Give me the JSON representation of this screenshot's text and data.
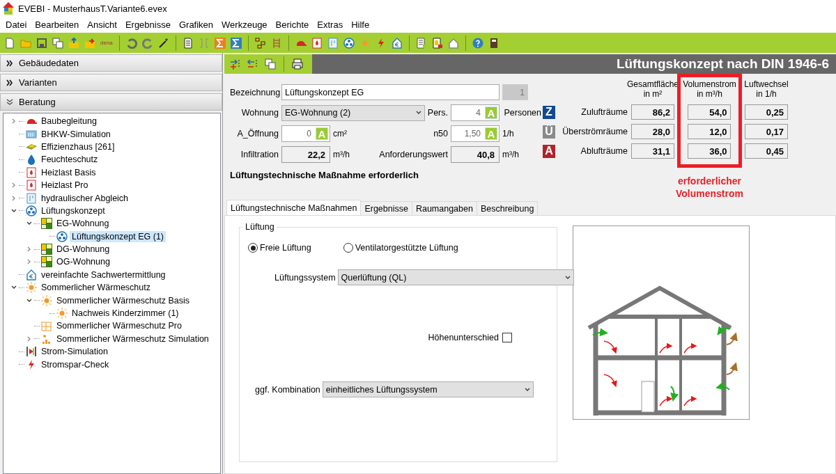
{
  "window": {
    "title": "EVEBI - MusterhausT.Variante6.evex"
  },
  "menu": [
    "Datei",
    "Bearbeiten",
    "Ansicht",
    "Ergebnisse",
    "Grafiken",
    "Werkzeuge",
    "Berichte",
    "Extras",
    "Hilfe"
  ],
  "toolbar": {
    "dena_label": "dena"
  },
  "sidebar": {
    "sections": [
      {
        "label": "Gebäudedaten",
        "expanded": false
      },
      {
        "label": "Varianten",
        "expanded": false
      },
      {
        "label": "Beratung",
        "expanded": true
      }
    ],
    "tree": [
      {
        "label": "Baubegleitung",
        "kind": "cap",
        "expanded": false,
        "selected": false
      },
      {
        "label": "BHKW-Simulation",
        "kind": "chp",
        "selected": false
      },
      {
        "label": "Effizienzhaus [261]",
        "kind": "effizienz",
        "selected": false
      },
      {
        "label": "Feuchteschutz",
        "kind": "drop",
        "selected": false
      },
      {
        "label": "Heizlast Basis",
        "kind": "heat",
        "selected": false
      },
      {
        "label": "Heizlast Pro",
        "kind": "heat",
        "expanded": false,
        "selected": false
      },
      {
        "label": "hydraulischer Abgleich",
        "kind": "hydraulic",
        "expanded": false,
        "selected": false
      },
      {
        "label": "Lüftungskonzept",
        "kind": "fan",
        "expanded": true,
        "selected": false,
        "children": [
          {
            "label": "EG-Wohnung",
            "kind": "flat",
            "expanded": true,
            "selected": false,
            "children": [
              {
                "label": "Lüftungskonzept EG (1)",
                "kind": "fan",
                "selected": true
              }
            ]
          },
          {
            "label": "DG-Wohnung",
            "kind": "flat",
            "expanded": false,
            "selected": false
          },
          {
            "label": "OG-Wohnung",
            "kind": "flat",
            "expanded": false,
            "selected": false
          }
        ]
      },
      {
        "label": "vereinfachte Sachwertermittlung",
        "kind": "euro-house",
        "selected": false
      },
      {
        "label": "Sommerlicher Wärmeschutz",
        "kind": "sun",
        "expanded": true,
        "selected": false,
        "children": [
          {
            "label": "Sommerlicher Wärmeschutz Basis",
            "kind": "sun",
            "expanded": true,
            "selected": false,
            "children": [
              {
                "label": "Nachweis Kinderzimmer (1)",
                "kind": "sun",
                "selected": false
              }
            ]
          },
          {
            "label": "Sommerlicher Wärmeschutz Pro",
            "kind": "grid",
            "selected": false
          },
          {
            "label": "Sommerlicher Wärmeschutz Simulation",
            "kind": "chart-sun",
            "expanded": false,
            "selected": false
          }
        ]
      },
      {
        "label": "Strom-Simulation",
        "kind": "power",
        "selected": false
      },
      {
        "label": "Stromspar-Check",
        "kind": "bolt",
        "selected": false
      }
    ]
  },
  "panel": {
    "title": "Lüftungskonzept nach DIN 1946-6",
    "form": {
      "name": {
        "label": "Bezeichnung",
        "value": "Lüftungskonzept EG",
        "number": "1"
      },
      "dwelling": {
        "label": "Wohnung",
        "value": "EG-Wohnung (2)"
      },
      "persons": {
        "label": "Pers.",
        "value": "4",
        "button": "A",
        "unit": "Personen"
      },
      "opening": {
        "label": "A_Öffnung",
        "value": "0",
        "button": "A",
        "unit": "cm²"
      },
      "n50": {
        "label": "n50",
        "value": "1,50",
        "button": "A",
        "unit": "1/h"
      },
      "infiltration": {
        "label": "Infiltration",
        "value": "22,2",
        "unit": "m³/h"
      },
      "requirement": {
        "label": "Anforderungswert",
        "value": "40,8",
        "unit": "m³/h"
      },
      "message": "Lüftungstechnische Maßnahme erforderlich"
    },
    "summary": {
      "columns": [
        {
          "heading": "Gesamtfläche",
          "unit": "in m²",
          "highlighted": false
        },
        {
          "heading": "Volumenstrom",
          "unit": "in m³/h",
          "highlighted": true
        },
        {
          "heading": "Luftwechsel",
          "unit": "in 1/h",
          "highlighted": false
        }
      ],
      "rows": [
        {
          "badge": "Z",
          "color": "#124a91",
          "label": "Zulufträume",
          "values": [
            "86,2",
            "54,0",
            "0,25"
          ]
        },
        {
          "badge": "Ü",
          "color": "#8a8a8a",
          "label": "Überströmräume",
          "values": [
            "28,0",
            "12,0",
            "0,17"
          ]
        },
        {
          "badge": "A",
          "color": "#b3222a",
          "label": "Ablufträume",
          "values": [
            "31,1",
            "36,0",
            "0,45"
          ]
        }
      ],
      "note": "erforderlicher\nVolumenstrom"
    },
    "tabs": [
      {
        "label": "Lüftungstechnische Maßnahmen",
        "selected": true
      },
      {
        "label": "Ergebnisse",
        "selected": false
      },
      {
        "label": "Raumangaben",
        "selected": false
      },
      {
        "label": "Beschreibung",
        "selected": false
      }
    ],
    "ventilation": {
      "group": "Lüftung",
      "radios": [
        {
          "label": "Freie Lüftung",
          "selected": true
        },
        {
          "label": "Ventilatorgestützte Lüftung",
          "selected": false
        }
      ],
      "system": {
        "label": "Lüftungssystem",
        "value": "Querlüftung (QL)"
      },
      "height_difference": {
        "label": "Höhenunterschied",
        "checked": false
      },
      "combination": {
        "label": "ggf. Kombination",
        "value": "einheitliches Lüftungssystem"
      }
    }
  }
}
